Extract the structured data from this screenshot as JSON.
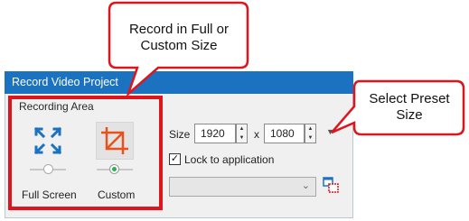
{
  "window": {
    "title": "Record Video Project"
  },
  "recording_area": {
    "group_label": "Recording Area",
    "modes": [
      {
        "label": "Full Screen",
        "icon": "fullscreen-arrows-icon",
        "selected": false
      },
      {
        "label": "Custom",
        "icon": "crop-icon",
        "selected": true
      }
    ]
  },
  "size": {
    "label": "Size",
    "width": "1920",
    "separator": "x",
    "height": "1080",
    "preset_arrow": "▼"
  },
  "lock": {
    "label": "Lock to application",
    "checked": true,
    "check_glyph": "✓"
  },
  "application_combo": {
    "value": "",
    "chevron": "⌄"
  },
  "callouts": {
    "top": {
      "line1": "Record in Full or",
      "line2": "Custom Size"
    },
    "right": {
      "line1": "Select Preset",
      "line2": "Size"
    }
  },
  "colors": {
    "title_bar": "#1a72c0",
    "highlight": "#e0141c",
    "icon_blue": "#1a72c0",
    "icon_orange": "#e8501c",
    "active_knob": "#2bb24c"
  }
}
